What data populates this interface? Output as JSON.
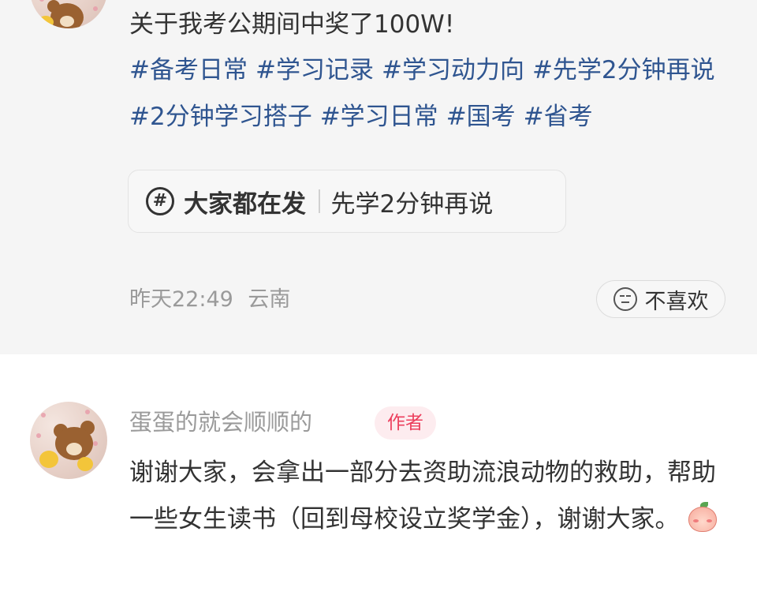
{
  "post": {
    "title": "关于我考公期间中奖了100W!",
    "hashtags": [
      "#备考日常",
      "#学习记录",
      "#学习动力向",
      "#先学2分钟再说",
      "#2分钟学习搭子",
      "#学习日常",
      "#国考",
      "#省考"
    ],
    "topic": {
      "icon": "hashtag-icon",
      "icon_glyph": "#",
      "label": "大家都在发",
      "name": "先学2分钟再说"
    },
    "meta": {
      "time": "昨天22:49",
      "location": "云南"
    },
    "dislike": {
      "icon": "meh-face-icon",
      "label": "不喜欢"
    }
  },
  "comment": {
    "author": "蛋蛋的就会顺顺的",
    "badge": "作者",
    "text": "谢谢大家，会拿出一部分去资助流浪动物的救助，帮助一些女生读书（回到母校设立奖学金），谢谢大家。",
    "emoji": "peach-kiss-emoji"
  },
  "colors": {
    "hashtag": "#2f5590",
    "badge_text": "#ec3f5d",
    "badge_bg": "#fdecef",
    "post_bg": "#f5f5f5"
  }
}
